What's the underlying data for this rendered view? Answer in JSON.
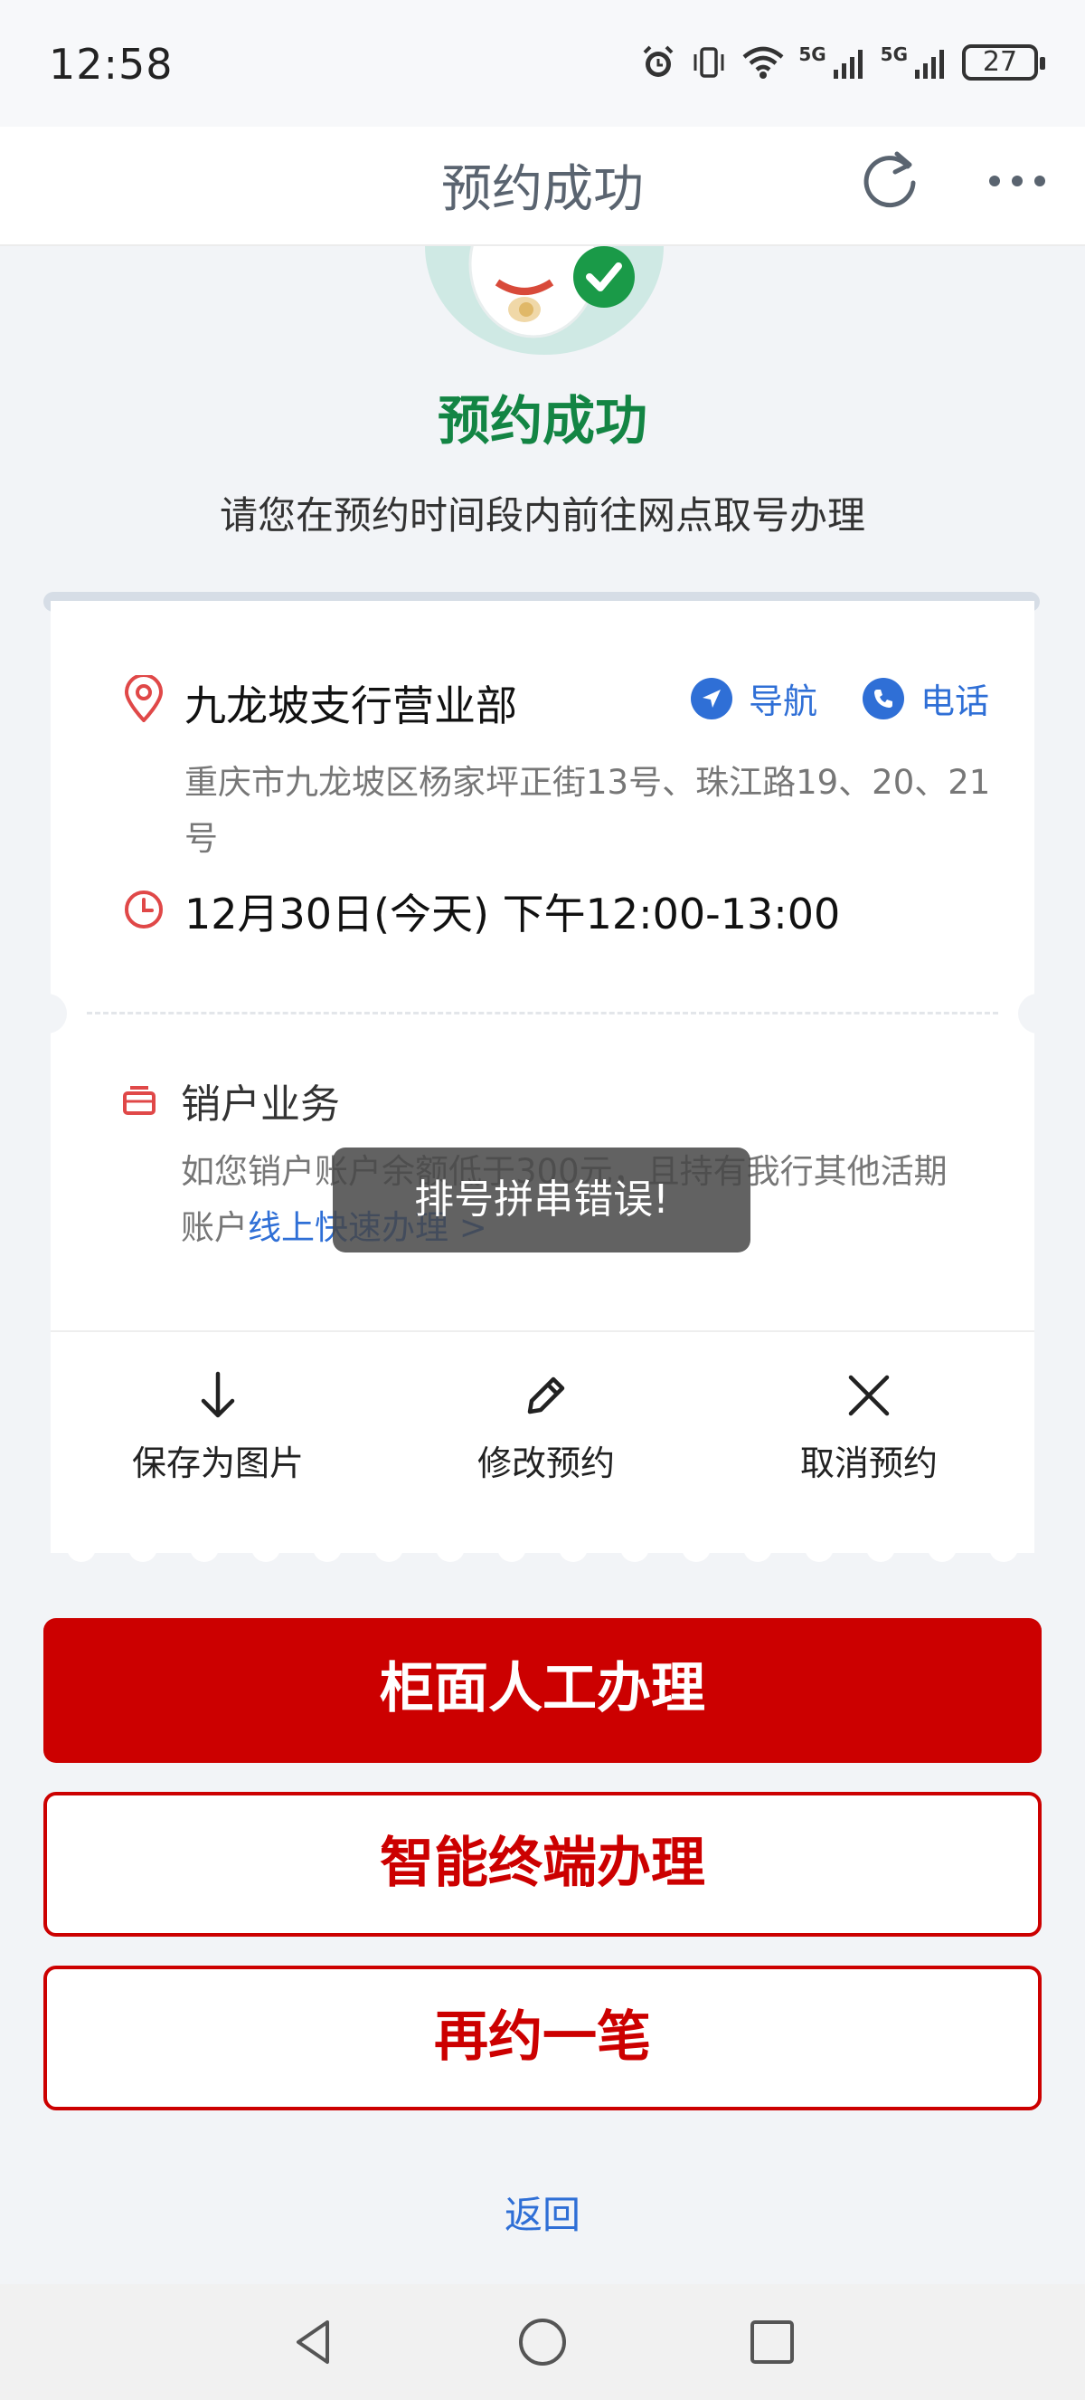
{
  "status_bar": {
    "time": "12:58",
    "signal_1": "5G",
    "signal_2": "5G",
    "battery": "27"
  },
  "header": {
    "title": "预约成功",
    "refresh_icon": "refresh-icon",
    "more_icon": "more-icon"
  },
  "hero": {
    "title": "预约成功",
    "subtitle": "请您在预约时间段内前往网点取号办理",
    "title_color": "#138544"
  },
  "ticket": {
    "branch_name": "九龙坡支行营业部",
    "navigate_label": "导航",
    "phone_label": "电话",
    "address": "重庆市九龙坡区杨家坪正街13号、珠江路19、20、21号",
    "time": "12月30日(今天) 下午12:00-13:00",
    "business_title": "销户业务",
    "business_desc": "如您销户账户余额低于300元，且持有我行其他活期账户",
    "business_link": "线上快速办理 >",
    "actions": [
      {
        "label": "保存为图片",
        "icon": "download-icon"
      },
      {
        "label": "修改预约",
        "icon": "pencil-icon"
      },
      {
        "label": "取消预约",
        "icon": "close-icon"
      }
    ]
  },
  "buttons": {
    "counter": "柜面人工办理",
    "terminal": "智能终端办理",
    "again": "再约一笔"
  },
  "back_label": "返回",
  "toast": "排号拼串错误!",
  "colors": {
    "accent_red": "#cc0000",
    "link_blue": "#2f6fd6",
    "success_green": "#138544"
  }
}
